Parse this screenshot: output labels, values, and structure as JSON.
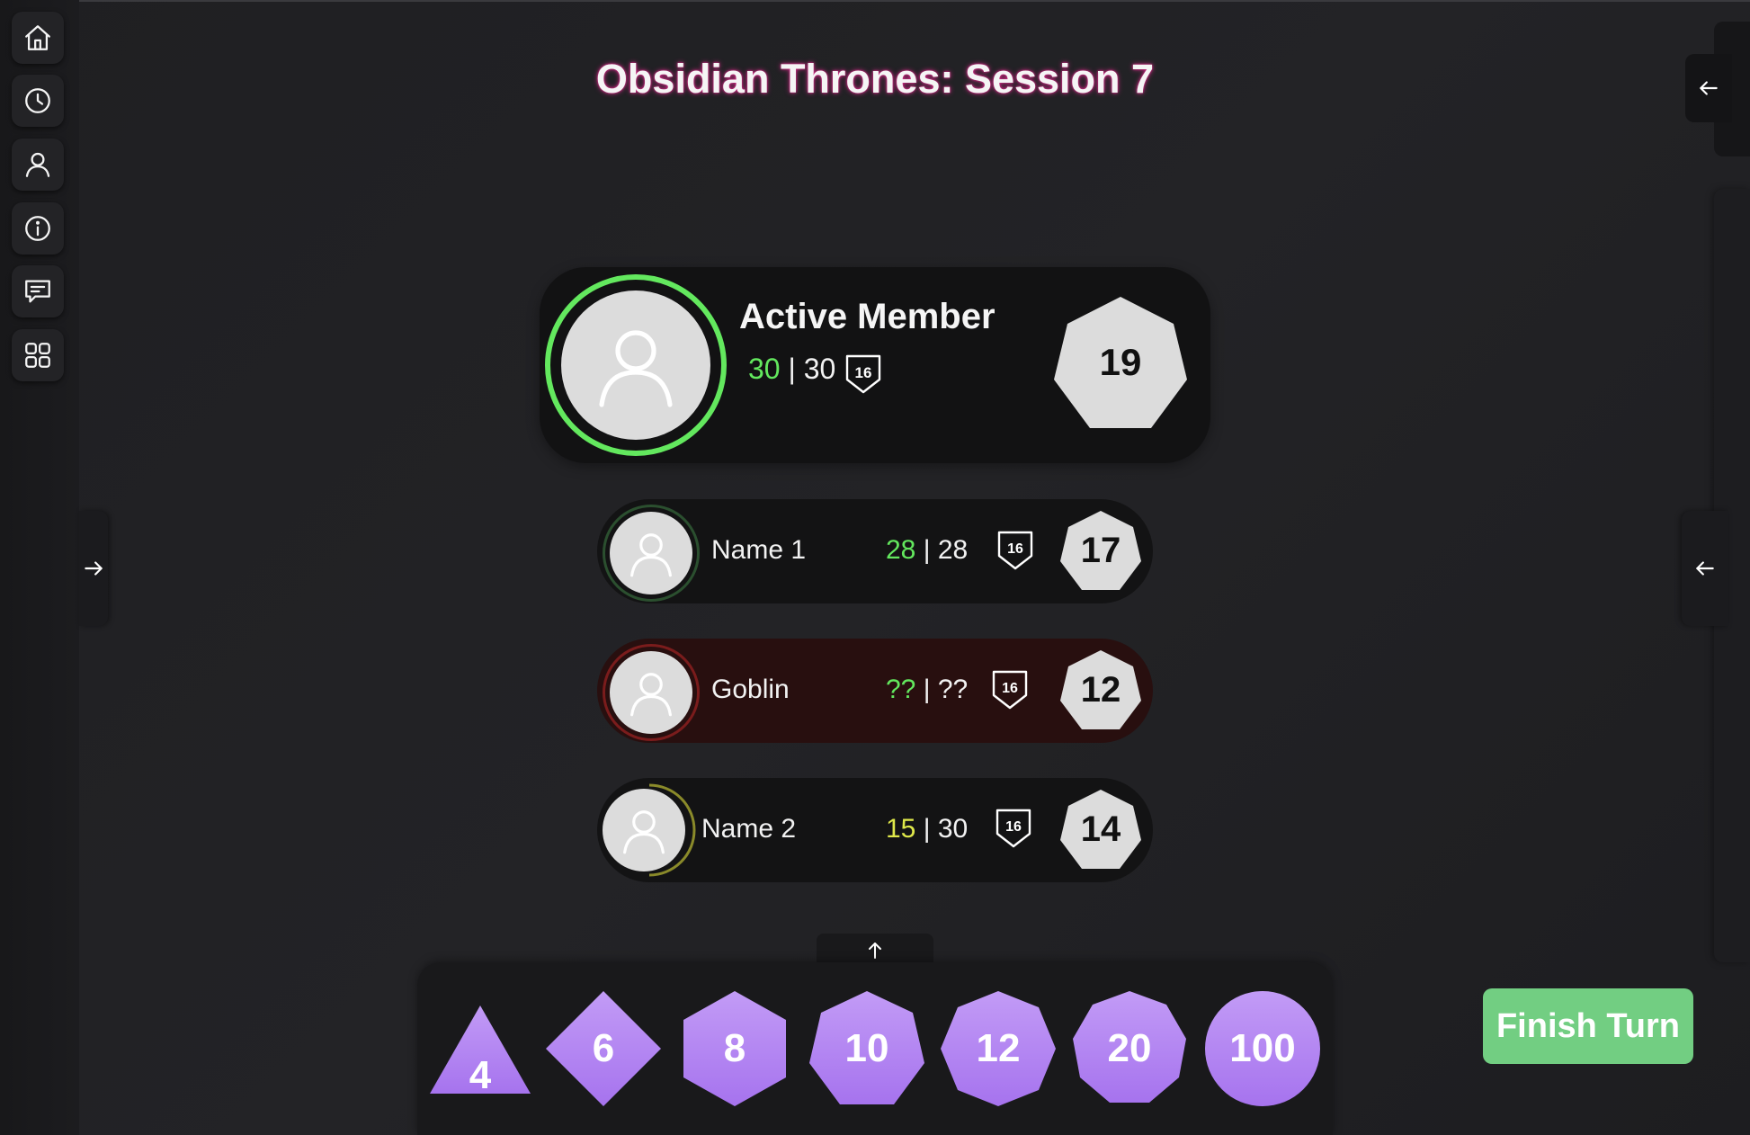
{
  "title": "Obsidian Thrones: Session 7",
  "sidebar": {
    "items": [
      {
        "icon": "home-icon"
      },
      {
        "icon": "clock-icon"
      },
      {
        "icon": "user-icon"
      },
      {
        "icon": "info-icon"
      },
      {
        "icon": "chat-icon"
      },
      {
        "icon": "grid-icon"
      }
    ]
  },
  "active": {
    "name": "Active Member",
    "hp_current": "30",
    "hp_max": "30",
    "hp_separator": " | ",
    "ac": "16",
    "initiative": "19",
    "ring_color": "#63e85e"
  },
  "combatants": [
    {
      "name": "Name 1",
      "hp_current": "28",
      "hp_max": "28",
      "ac": "16",
      "initiative": "17",
      "hp_fraction": 1.0,
      "type": "ally",
      "ring_color": "#2e5a33"
    },
    {
      "name": "Goblin",
      "hp_current": "??",
      "hp_max": "??",
      "ac": "16",
      "initiative": "12",
      "hp_fraction": 1.0,
      "type": "enemy",
      "ring_color": "#7a1c1c"
    },
    {
      "name": "Name 2",
      "hp_current": "15",
      "hp_max": "30",
      "ac": "16",
      "initiative": "14",
      "hp_fraction": 0.5,
      "type": "ally",
      "ring_color": "#8a8a2a"
    }
  ],
  "sep": " | ",
  "dice": [
    {
      "label": "4",
      "shape": "d4"
    },
    {
      "label": "6",
      "shape": "d6"
    },
    {
      "label": "8",
      "shape": "d8"
    },
    {
      "label": "10",
      "shape": "d10"
    },
    {
      "label": "12",
      "shape": "d12"
    },
    {
      "label": "20",
      "shape": "d20"
    },
    {
      "label": "100",
      "shape": "d100"
    }
  ],
  "finish_button": "Finish Turn",
  "colors": {
    "accent_purple": "#b07ef2",
    "hp_green": "#63e85e",
    "hp_yellow": "#dfe84a",
    "finish_green": "#72ce82",
    "title_glow": "#dc288c"
  }
}
